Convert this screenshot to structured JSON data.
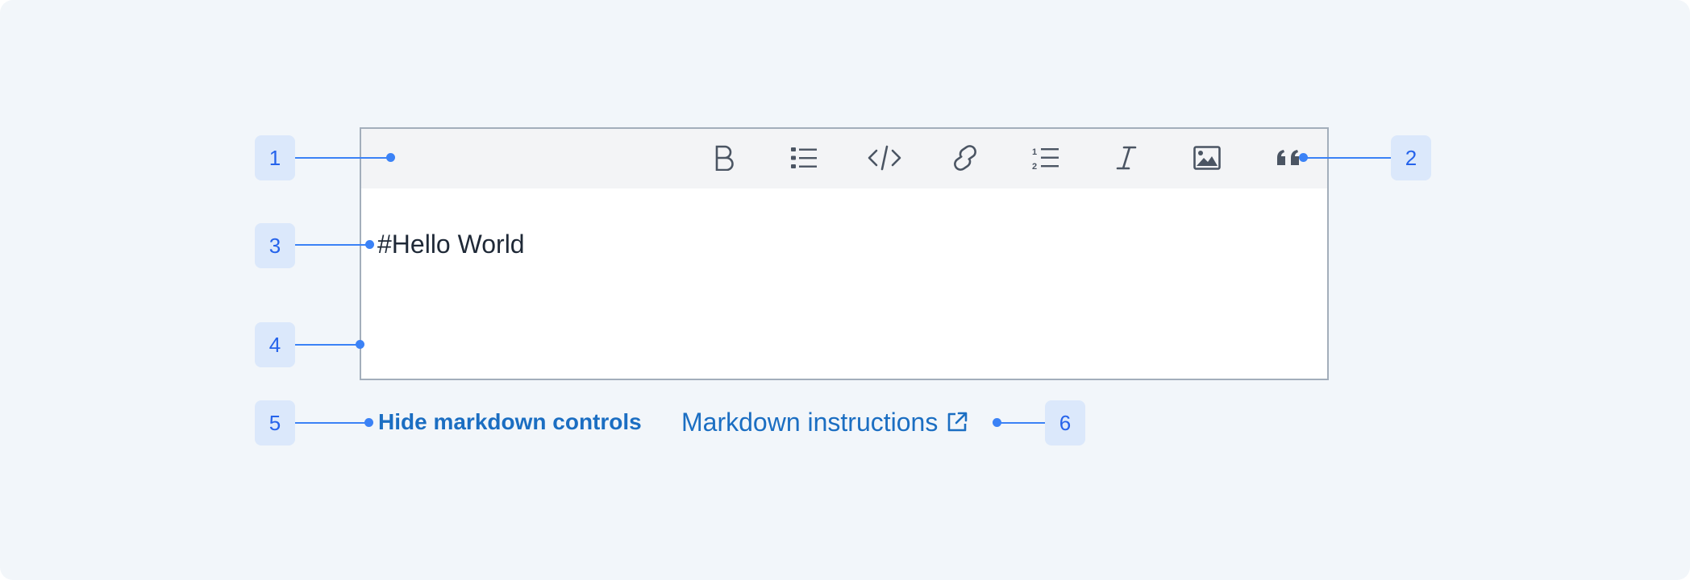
{
  "toolbar": {
    "tools": [
      {
        "name": "bold",
        "icon": "bold-icon"
      },
      {
        "name": "bulleted-list",
        "icon": "bulleted-list-icon"
      },
      {
        "name": "code",
        "icon": "code-icon"
      },
      {
        "name": "link",
        "icon": "link-icon"
      },
      {
        "name": "numbered-list",
        "icon": "numbered-list-icon"
      },
      {
        "name": "italic",
        "icon": "italic-icon"
      },
      {
        "name": "image",
        "icon": "image-icon"
      },
      {
        "name": "quote",
        "icon": "quote-icon"
      }
    ]
  },
  "editor": {
    "content": "#Hello World"
  },
  "footer": {
    "hide_controls_label": "Hide markdown controls",
    "instructions_label": "Markdown instructions",
    "external_icon": "external-link-icon"
  },
  "callouts": [
    "1",
    "2",
    "3",
    "4",
    "5",
    "6"
  ],
  "colors": {
    "link": "#1b6ec2",
    "callout_line": "#3b82f6",
    "callout_badge_bg": "#dbe8fb",
    "callout_badge_text": "#2563eb",
    "editor_border": "#a3aebb",
    "toolbar_bg": "#f3f4f6",
    "icon": "#4b5563"
  }
}
